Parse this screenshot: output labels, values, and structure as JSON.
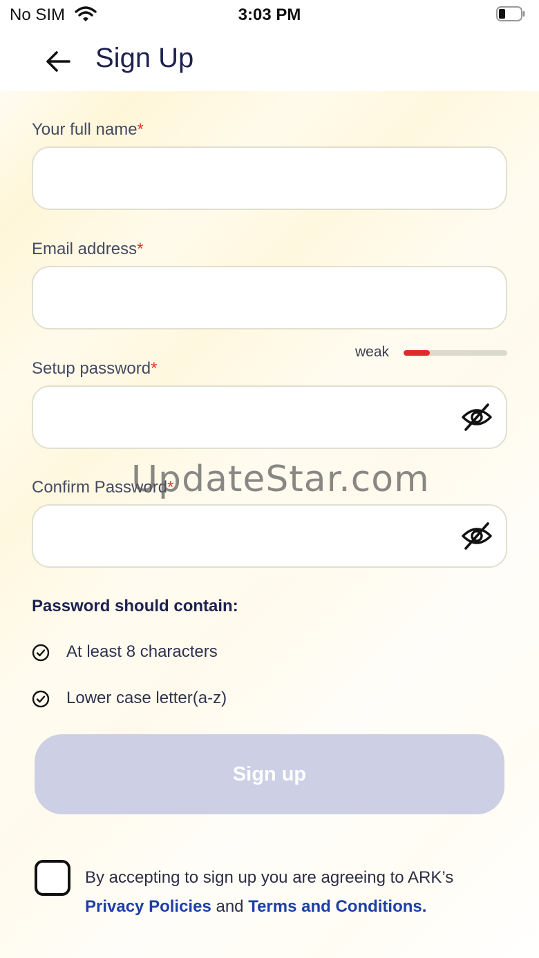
{
  "status_bar": {
    "carrier": "No SIM",
    "time": "3:03 PM"
  },
  "header": {
    "title": "Sign Up"
  },
  "form": {
    "full_name": {
      "label": "Your full name",
      "required_mark": "*",
      "value": "",
      "placeholder": ""
    },
    "email": {
      "label": "Email address",
      "required_mark": "*",
      "value": "",
      "placeholder": ""
    },
    "password": {
      "label": "Setup password",
      "required_mark": "*",
      "value": "",
      "placeholder": ""
    },
    "confirm_password": {
      "label": "Confirm Password",
      "required_mark": "*",
      "value": "",
      "placeholder": ""
    },
    "strength": {
      "label": "weak",
      "level_fraction": 0.25,
      "color": "#e02a2a"
    }
  },
  "requirements": {
    "title": "Password should contain:",
    "items": [
      {
        "text": "At least 8 characters"
      },
      {
        "text": "Lower case letter(a-z)"
      }
    ]
  },
  "signup_button": {
    "label": "Sign up",
    "enabled": false
  },
  "agreement": {
    "checked": false,
    "text_prefix": "By accepting to sign up you are agreeing to ARK’s",
    "privacy_link": "Privacy Policies",
    "connector": "and",
    "terms_link": "Terms and Conditions."
  },
  "watermark": "UpdateStar.com",
  "colors": {
    "accent": "#1d3ea8",
    "title": "#1d2150",
    "required": "#e0322a",
    "disabled_button": "#cdd0e4"
  }
}
